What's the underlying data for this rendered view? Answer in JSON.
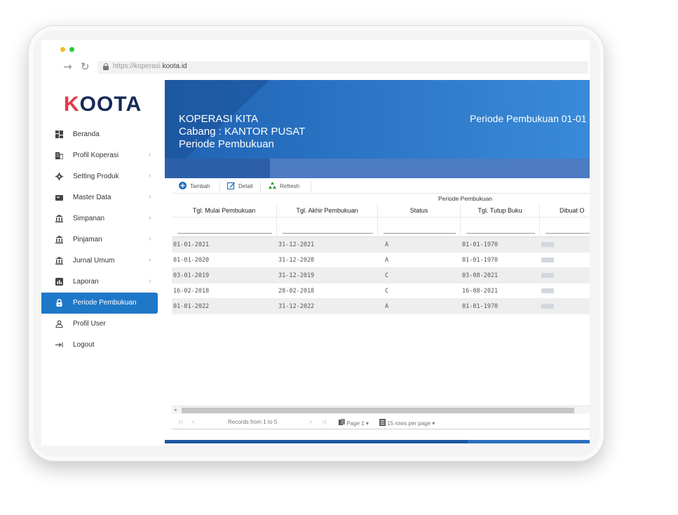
{
  "browser": {
    "url_prefix": "https://koperasi.",
    "url_domain": "koota.id",
    "dots": [
      "#f5b82e",
      "#27c93f"
    ]
  },
  "sidebar": {
    "logo_k": "K",
    "logo_rest": "OOTA",
    "items": [
      {
        "label": "Beranda",
        "icon": "dashboard-icon",
        "chevron": false
      },
      {
        "label": "Profil Koperasi",
        "icon": "building-icon",
        "chevron": true
      },
      {
        "label": "Setting Produk",
        "icon": "gear-icon",
        "chevron": true
      },
      {
        "label": "Master Data",
        "icon": "card-icon",
        "chevron": true
      },
      {
        "label": "Simpanan",
        "icon": "bank-icon",
        "chevron": true
      },
      {
        "label": "Pinjaman",
        "icon": "bank-icon",
        "chevron": true
      },
      {
        "label": "Jurnal Umum",
        "icon": "bank-icon",
        "chevron": true
      },
      {
        "label": "Laporan",
        "icon": "chart-icon",
        "chevron": true
      },
      {
        "label": "Periode Pembukuan",
        "icon": "lock-icon",
        "chevron": false,
        "active": true
      },
      {
        "label": "Profil User",
        "icon": "user-icon",
        "chevron": false
      },
      {
        "label": "Logout",
        "icon": "logout-icon",
        "chevron": false
      }
    ]
  },
  "banner": {
    "line1": "KOPERASI KITA",
    "line2": "Cabang : KANTOR PUSAT",
    "line3": "Periode Pembukuan",
    "right": "Periode Pembukuan 01-01"
  },
  "toolbar": {
    "tambah": "Tambah",
    "detail": "Detail",
    "refresh": "Refresh"
  },
  "grid": {
    "group_header": "Periode Pembukuan",
    "columns": [
      "Tgl. Mulai Pembukuan",
      "Tgl. Akhir Pembukuan",
      "Status",
      "Tgl. Tutup Buku",
      "Dibuat O"
    ],
    "rows": [
      [
        "01-01-2021",
        "31-12-2021",
        "A",
        "01-01-1970"
      ],
      [
        "01-01-2020",
        "31-12-2020",
        "A",
        "01-01-1970"
      ],
      [
        "03-01-2019",
        "31-12-2019",
        "C",
        "03-08-2021"
      ],
      [
        "16-02-2018",
        "28-02-2018",
        "C",
        "16-08-2021"
      ],
      [
        "01-01-2022",
        "31-12-2022",
        "A",
        "01-01-1970"
      ]
    ]
  },
  "pager": {
    "first": "|<",
    "prev": "<",
    "records": "Records from 1 to 5",
    "next": ">",
    "last": ">|",
    "page": "Page 1",
    "rows_per_page": "15 rows per page"
  }
}
